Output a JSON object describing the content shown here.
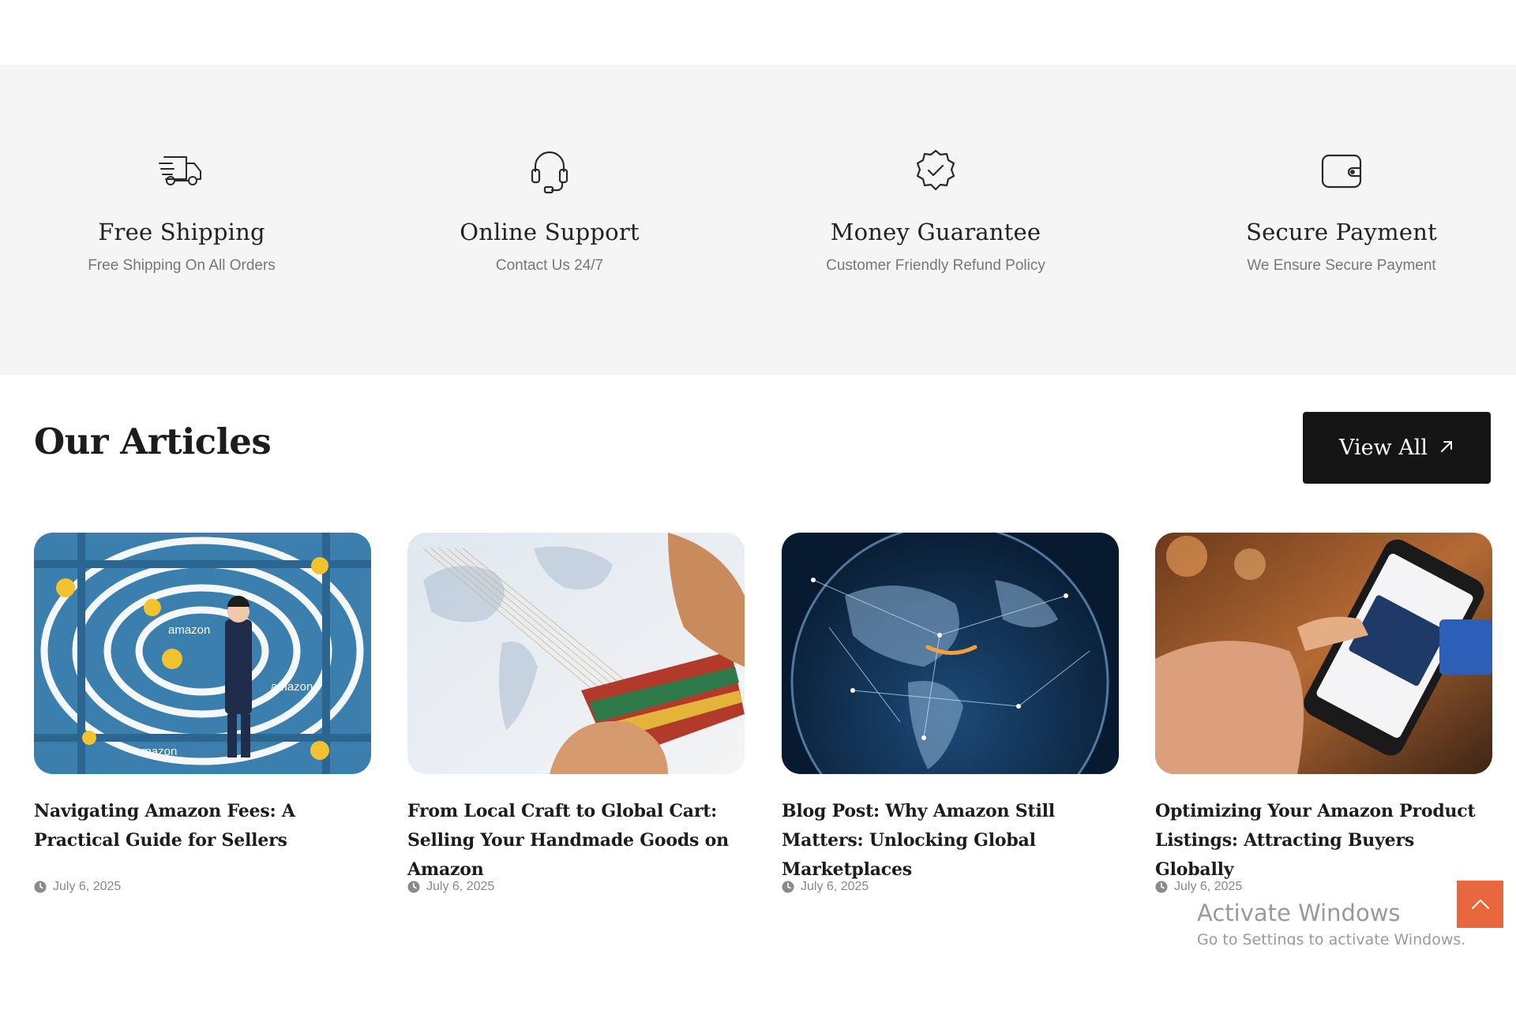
{
  "features": [
    {
      "icon": "truck-icon",
      "title": "Free Shipping",
      "subtitle": "Free Shipping On All Orders"
    },
    {
      "icon": "headset-icon",
      "title": "Online Support",
      "subtitle": "Contact Us 24/7"
    },
    {
      "icon": "badge-check-icon",
      "title": "Money Guarantee",
      "subtitle": "Customer Friendly Refund Policy"
    },
    {
      "icon": "wallet-icon",
      "title": "Secure Payment",
      "subtitle": "We Ensure Secure Payment"
    }
  ],
  "articles": {
    "heading": "Our Articles",
    "view_all_label": "View All",
    "items": [
      {
        "title": "Navigating Amazon Fees: A Practical Guide for Sellers",
        "date": "July 6, 2025",
        "image": "amazon-maze-illustration"
      },
      {
        "title": "From Local Craft to Global Cart: Selling Your Handmade Goods on Amazon",
        "date": "July 6, 2025",
        "image": "weaving-hands-photo"
      },
      {
        "title": "Blog Post: Why Amazon Still Matters: Unlocking Global Marketplaces",
        "date": "July 6, 2025",
        "image": "network-globe-photo"
      },
      {
        "title": "Optimizing Your Amazon Product Listings: Attracting Buyers Globally",
        "date": "July 6, 2025",
        "image": "phone-shopping-photo"
      }
    ]
  },
  "watermark": {
    "line1": "Activate Windows",
    "line2": "Go to Settings to activate Windows."
  },
  "colors": {
    "feature_band": "#f5f5f5",
    "button_dark": "#151515",
    "scroll_top": "#e8673f"
  }
}
